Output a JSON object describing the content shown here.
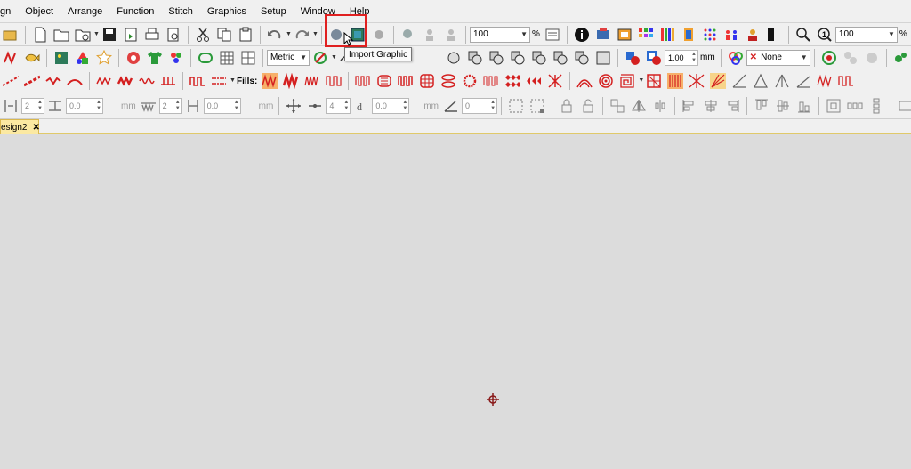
{
  "menu": [
    "gn",
    "Object",
    "Arrange",
    "Function",
    "Stitch",
    "Graphics",
    "Setup",
    "Window",
    "Help"
  ],
  "toolbar1": {
    "zoom_value_1": "100",
    "zoom_unit_1": "%",
    "zoom_value_2": "100",
    "zoom_unit_2": "%"
  },
  "toolbar2": {
    "units_select": "Metric",
    "size_value": "1.00",
    "size_unit": "mm",
    "none_select": "None"
  },
  "toolbar3": {
    "fills_label": "Fills:"
  },
  "toolbar4": {
    "f1": "2",
    "f2": "0.0",
    "f2u": "mm",
    "f3": "2",
    "f4": "0.0",
    "f4u": "mm",
    "f5": "4",
    "f6": "0.0",
    "f6u": "mm",
    "f7": "0"
  },
  "tab": {
    "label": "esign2",
    "close": "✕"
  },
  "tooltip": "Import Graphic",
  "colors": {
    "accent_red": "#e02020",
    "tab_bg": "#fbe9a2",
    "stitch_red": "#d42020"
  }
}
